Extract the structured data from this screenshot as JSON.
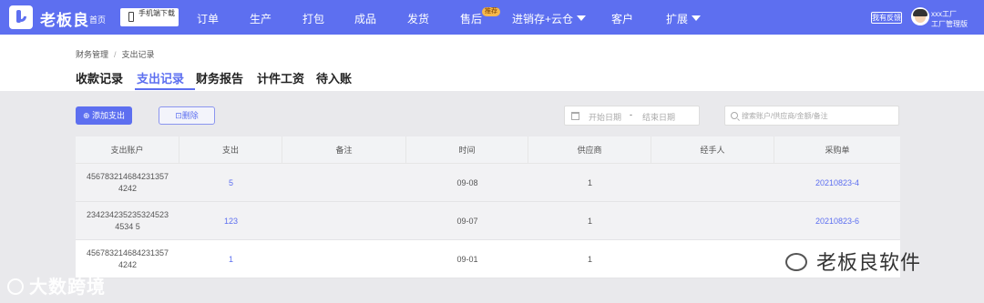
{
  "topbar": {
    "brand": "老板良",
    "home": "首页",
    "app_download": "手机端下载",
    "nav": [
      {
        "label": "订单"
      },
      {
        "label": "生产"
      },
      {
        "label": "打包"
      },
      {
        "label": "成品"
      },
      {
        "label": "发货"
      },
      {
        "label": "售后",
        "badge": "推荐"
      },
      {
        "label": "进销存+云仓",
        "dropdown": true
      },
      {
        "label": "客户"
      },
      {
        "label": "扩展",
        "dropdown": true
      }
    ],
    "feedback": "我有反馈",
    "user_name": "xxx工厂",
    "user_role": "工厂管理版"
  },
  "breadcrumb": [
    "财务管理",
    "支出记录"
  ],
  "tabs": [
    {
      "label": "收款记录",
      "active": false
    },
    {
      "label": "支出记录",
      "active": true
    },
    {
      "label": "财务报告",
      "active": false
    },
    {
      "label": "计件工资",
      "active": false
    },
    {
      "label": "待入账",
      "active": false
    }
  ],
  "toolbar": {
    "add_label": "⊕ 添加支出",
    "delete_label": "⊡删除",
    "date_start_placeholder": "开始日期",
    "date_sep": "-",
    "date_end_placeholder": "结束日期",
    "search_placeholder": "搜索账户/供应商/金额/备注"
  },
  "table": {
    "columns": [
      "支出账户",
      "支出",
      "备注",
      "时间",
      "供应商",
      "经手人",
      "采购单"
    ],
    "rows": [
      {
        "account": "4567832146842313574242",
        "amount": "5",
        "note": "",
        "time": "09-08",
        "supplier": "1",
        "handler": "",
        "purchase": "20210823-4"
      },
      {
        "account": "2342342352353245234534 5",
        "amount": "123",
        "note": "",
        "time": "09-07",
        "supplier": "1",
        "handler": "",
        "purchase": "20210823-6"
      },
      {
        "account": "4567832146842313574242",
        "amount": "1",
        "note": "",
        "time": "09-01",
        "supplier": "1",
        "handler": "",
        "purchase": ""
      }
    ]
  },
  "watermarks": {
    "left": "大数跨境",
    "right": "老板良软件"
  },
  "colors": {
    "primary": "#5d6ff0",
    "badge": "#f5b84c"
  }
}
